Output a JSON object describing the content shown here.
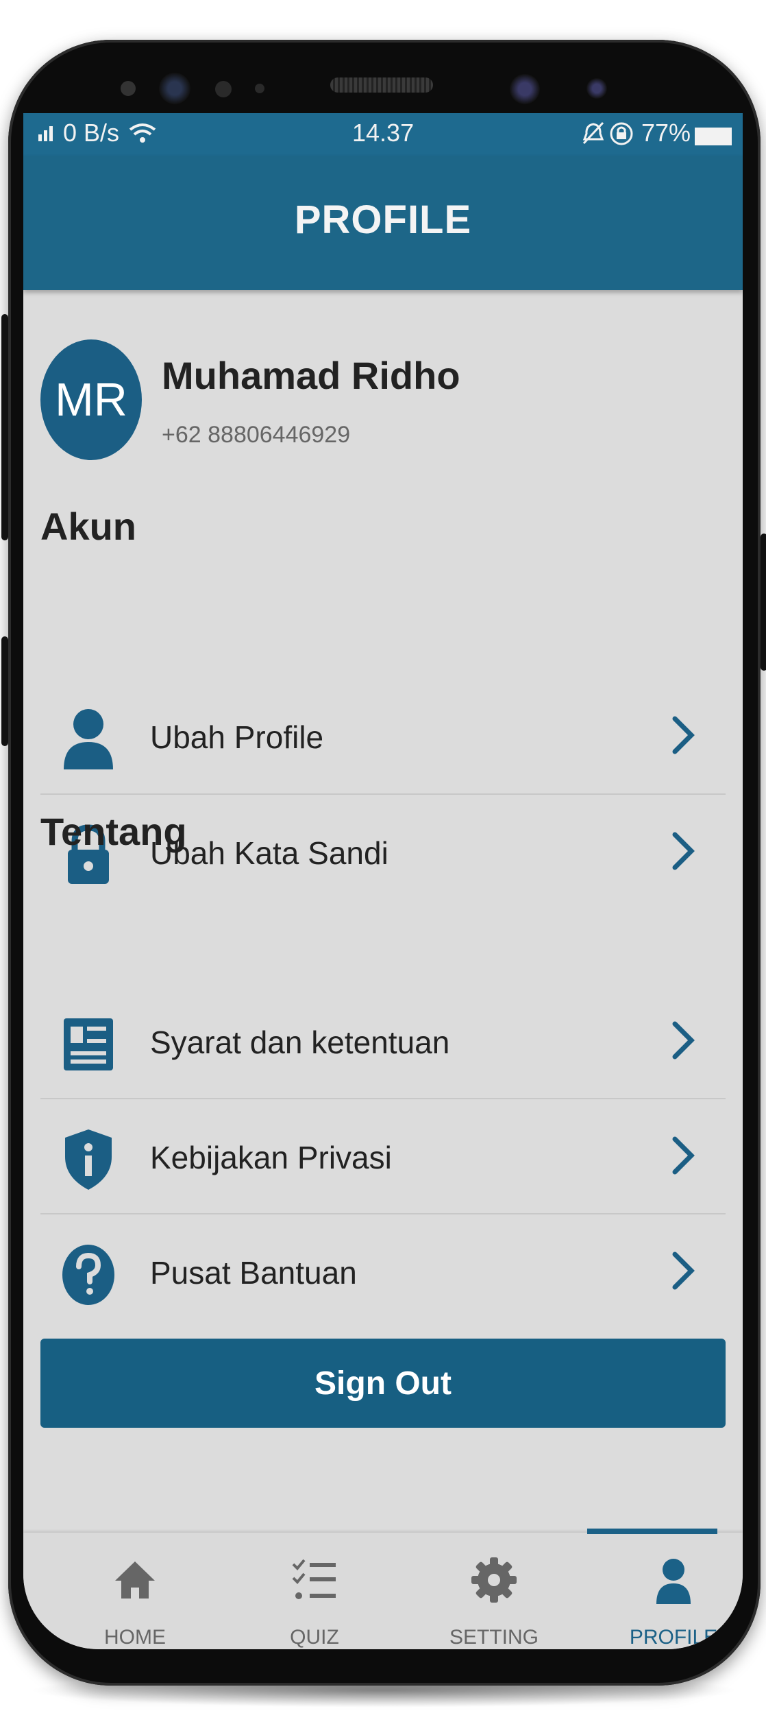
{
  "status_bar": {
    "signal": "0 B/s",
    "time": "14.37",
    "battery": "77%"
  },
  "header": {
    "title": "PROFILE"
  },
  "profile": {
    "initials": "MR",
    "name": "Muhamad Ridho",
    "phone": "+62 88806446929"
  },
  "sections": {
    "akun": "Akun",
    "tentang": "Tentang"
  },
  "menu": {
    "ubah_profile": {
      "label": "Ubah Profile",
      "icon": "person-icon"
    },
    "ubah_kata_sandi": {
      "label": "Ubah Kata Sandi",
      "icon": "lock-icon"
    },
    "syarat": {
      "label": "Syarat dan ketentuan",
      "icon": "document-icon"
    },
    "privasi": {
      "label": "Kebijakan Privasi",
      "icon": "shield-info-icon"
    },
    "bantuan": {
      "label": "Pusat Bantuan",
      "icon": "help-icon"
    }
  },
  "sign_out": "Sign Out",
  "bottom_nav": {
    "home": "HOME",
    "quiz": "QUIZ",
    "setting": "SETTING",
    "profile": "PROFILE",
    "active": "PROFILE"
  },
  "colors": {
    "primary": "#1d6688",
    "background": "#dcdcdc",
    "text": "#222222",
    "nav_inactive": "#666666"
  }
}
